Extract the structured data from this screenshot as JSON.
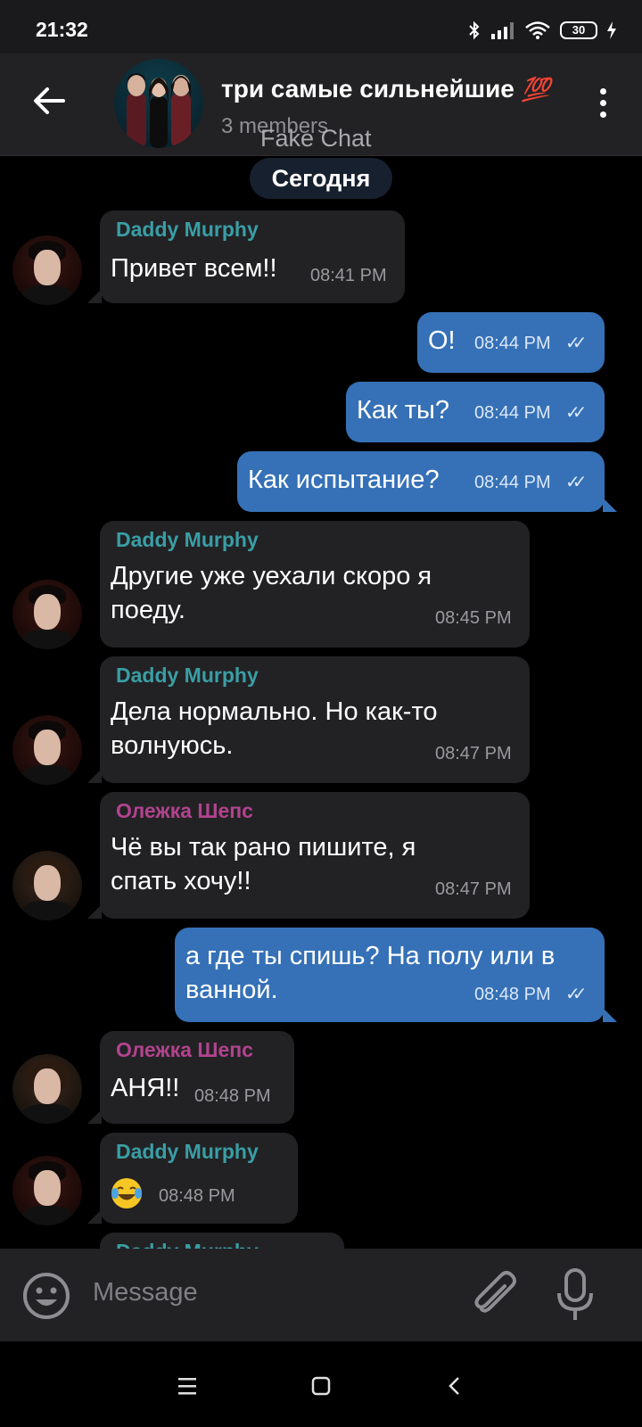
{
  "status_bar": {
    "time": "21:32",
    "battery": "30"
  },
  "header": {
    "title": "три самые сильнейшие",
    "title_emoji": "💯",
    "subtitle": "3 members",
    "watermark": "Fake Chat"
  },
  "chat": {
    "date_label": "Сегодня",
    "messages": [
      {
        "sender": "Daddy Murphy",
        "text": "Привет всем!!",
        "time": "08:41 PM"
      },
      {
        "text": "О!",
        "time": "08:44 PM",
        "ticks": "✓✓"
      },
      {
        "text": "Как ты?",
        "time": "08:44 PM",
        "ticks": "✓✓"
      },
      {
        "text": "Как испытание?",
        "time": "08:44 PM",
        "ticks": "✓✓"
      },
      {
        "sender": "Daddy Murphy",
        "text_line1": "Другие уже уехали скоро я",
        "text_line2": "поеду.",
        "time": "08:45 PM"
      },
      {
        "sender": "Daddy Murphy",
        "text_line1": "Дела нормально. Но как-то",
        "text_line2": "волнуюсь.",
        "time": "08:47 PM"
      },
      {
        "sender": "Олежка Шепс",
        "text_line1": "Чё вы так рано пишите, я",
        "text_line2": "спать хочу!!",
        "time": "08:47 PM"
      },
      {
        "text_line1": "а где ты спишь? На полу или в",
        "text_line2": "ванной.",
        "time": "08:48 PM",
        "ticks": "✓✓"
      },
      {
        "sender": "Олежка Шепс",
        "text": "АНЯ!!",
        "time": "08:48 PM"
      },
      {
        "sender": "Daddy Murphy",
        "emoji": "laughing-tears",
        "time": "08:48 PM"
      },
      {
        "sender": "Daddy Murphy"
      }
    ]
  },
  "input": {
    "placeholder": "Message"
  },
  "colors": {
    "incoming_bubble": "#222224",
    "outgoing_bubble": "#3671b7",
    "sender_teal": "#3a9ea5",
    "sender_pink": "#b2438e"
  }
}
